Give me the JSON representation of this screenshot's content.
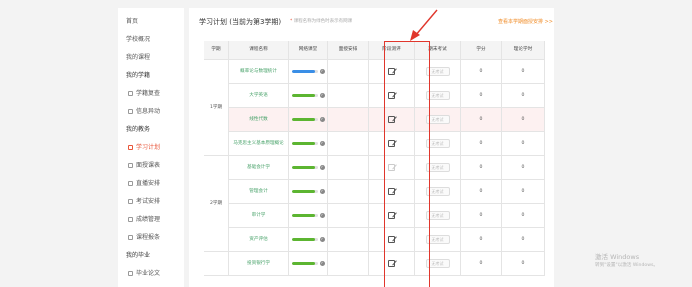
{
  "sidebar": {
    "items": [
      {
        "label": "首页",
        "type": "link"
      },
      {
        "label": "学校概况",
        "type": "link"
      },
      {
        "label": "我的课程",
        "type": "link"
      },
      {
        "label": "我的学籍",
        "type": "section"
      },
      {
        "label": "学籍复查",
        "type": "sub",
        "icon": "document-icon"
      },
      {
        "label": "信息异动",
        "type": "sub",
        "icon": "document-icon"
      },
      {
        "label": "我的教务",
        "type": "section"
      },
      {
        "label": "学习计划",
        "type": "sub",
        "icon": "plan-icon",
        "active": true
      },
      {
        "label": "面授课表",
        "type": "sub",
        "icon": "calendar-icon"
      },
      {
        "label": "直播安排",
        "type": "sub",
        "icon": "calendar-icon"
      },
      {
        "label": "考试安排",
        "type": "sub",
        "icon": "calendar-icon"
      },
      {
        "label": "成绩管理",
        "type": "sub",
        "icon": "grade-icon"
      },
      {
        "label": "课程报条",
        "type": "sub",
        "icon": "document-icon"
      },
      {
        "label": "我的毕业",
        "type": "section"
      },
      {
        "label": "毕业论文",
        "type": "sub",
        "icon": "document-icon"
      }
    ]
  },
  "main": {
    "title": "学习计划 (当前为第3学期)",
    "hint_star": "*",
    "hint": "课程名称为绿色时表示有网课",
    "top_link": "查看本学期面授安排 >>"
  },
  "table": {
    "headers": [
      "学期",
      "课程名称",
      "网络课堂",
      "面授安排",
      "阶段测评",
      "期末考试",
      "学分",
      "理论学时"
    ],
    "semesters": [
      {
        "label": "1学期",
        "rows": [
          {
            "course": "概率论与数理统计",
            "progress": 0.9,
            "bar_color": "#3a8ee6",
            "edit_faded": false,
            "exam": "无考试",
            "credit": "0",
            "hours": "0"
          },
          {
            "course": "大学英语",
            "progress": 0.9,
            "bar_color": "#5cb531",
            "edit_faded": false,
            "exam": "无考试",
            "credit": "0",
            "hours": "0"
          },
          {
            "course": "线性代数",
            "progress": 0.9,
            "bar_color": "#5cb531",
            "edit_faded": false,
            "exam": "无考试",
            "credit": "0",
            "hours": "0",
            "highlight": true
          },
          {
            "course": "马克思主义基本原理概论",
            "progress": 0.9,
            "bar_color": "#5cb531",
            "edit_faded": false,
            "exam": "无考试",
            "credit": "0",
            "hours": "0"
          }
        ]
      },
      {
        "label": "2学期",
        "rows": [
          {
            "course": "基础会计学",
            "progress": 0.9,
            "bar_color": "#5cb531",
            "edit_faded": true,
            "exam": "无考试",
            "credit": "0",
            "hours": "0"
          },
          {
            "course": "管理会计",
            "progress": 0.9,
            "bar_color": "#5cb531",
            "edit_faded": false,
            "exam": "无考试",
            "credit": "0",
            "hours": "0"
          },
          {
            "course": "审计学",
            "progress": 0.9,
            "bar_color": "#5cb531",
            "edit_faded": false,
            "exam": "无考试",
            "credit": "0",
            "hours": "0"
          },
          {
            "course": "资产评估",
            "progress": 0.9,
            "bar_color": "#5cb531",
            "edit_faded": false,
            "exam": "无考试",
            "credit": "0",
            "hours": "0"
          }
        ]
      },
      {
        "label": "",
        "rows": [
          {
            "course": "投资银行学",
            "progress": 0.9,
            "bar_color": "#5cb531",
            "edit_faded": false,
            "exam": "无考试",
            "credit": "0",
            "hours": "0"
          }
        ]
      }
    ],
    "progress_badge": "✓"
  },
  "watermark": {
    "title": "激活 Windows",
    "subtitle": "转到\"设置\"以激活 Windows。"
  },
  "colors": {
    "accent": "#e8563a",
    "link_orange": "#f08a24",
    "course_green": "#4aa36b",
    "annotation_red": "#e0362c"
  }
}
